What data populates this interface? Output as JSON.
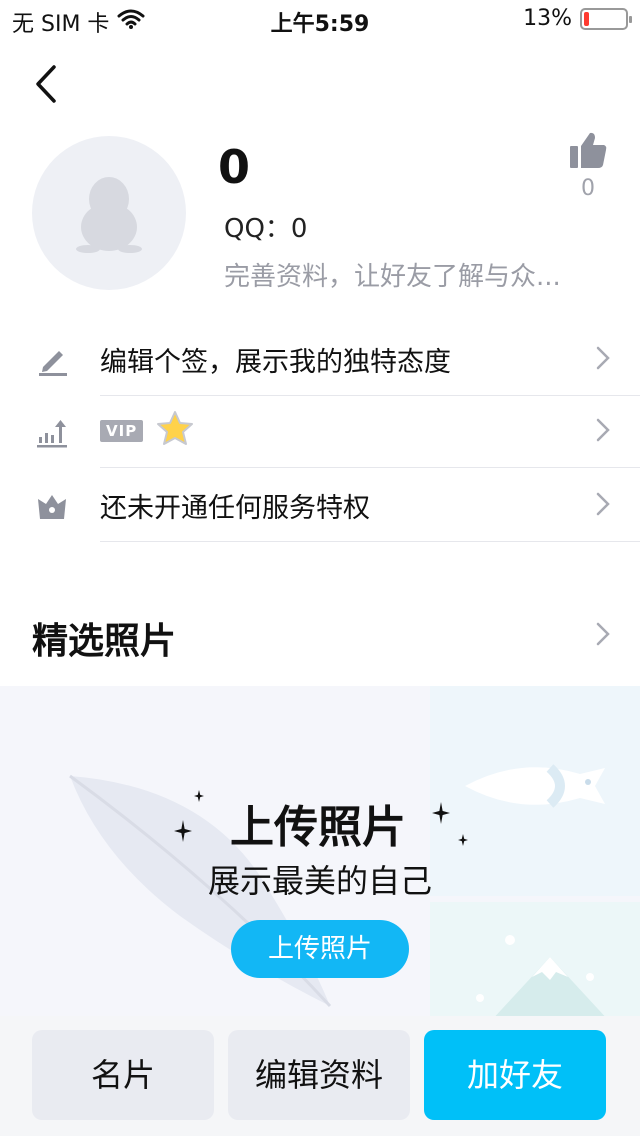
{
  "status_bar": {
    "carrier": "无 SIM 卡",
    "time": "上午5:59",
    "battery_text": "13%",
    "battery_level": 0.13,
    "battery_color": "#ff3b30"
  },
  "profile": {
    "name": "0",
    "qq_line": "QQ：0",
    "bio": "完善资料，让好友了解与众...",
    "like_count": "0"
  },
  "rows": [
    {
      "icon": "pencil-icon",
      "label": "编辑个签，展示我的独特态度"
    },
    {
      "icon": "level-chart-icon",
      "badge": "VIP",
      "star_icon": "star-icon"
    },
    {
      "icon": "crown-icon",
      "label": "还未开通任何服务特权"
    }
  ],
  "photos": {
    "section_title": "精选照片",
    "upload_title": "上传照片",
    "upload_subtitle": "展示最美的自己",
    "upload_button": "上传照片"
  },
  "bottom_bar": {
    "card_label": "名片",
    "edit_label": "编辑资料",
    "add_friend_label": "加好友"
  },
  "colors": {
    "accent": "#00c0f8",
    "upload_button": "#12b7f5",
    "muted_text": "#9a9ca5"
  }
}
